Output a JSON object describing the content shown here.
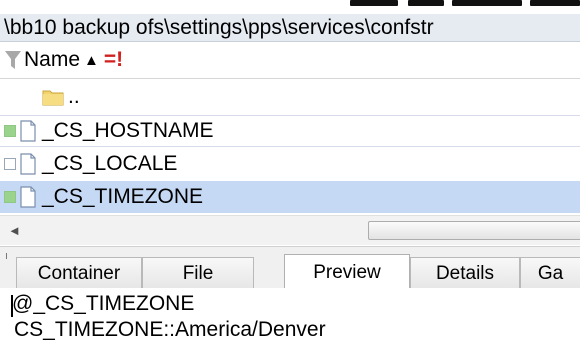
{
  "path_bar": {
    "text": "\\bb10 backup ofs\\settings\\pps\\services\\confstr"
  },
  "list": {
    "header": {
      "name_label": "Name",
      "sort_glyph": "▲",
      "flag": "=!"
    },
    "parent_row": {
      "label": ".."
    },
    "rows": [
      {
        "name": "_CS_HOSTNAME",
        "checkbox": "green"
      },
      {
        "name": "_CS_LOCALE",
        "checkbox": "empty"
      },
      {
        "name": "_CS_TIMEZONE",
        "checkbox": "green",
        "selected": true
      }
    ]
  },
  "scrollbar": {
    "left_arrow": "◄"
  },
  "tabs": [
    {
      "label": "Container"
    },
    {
      "label": "File"
    },
    {
      "label": "Preview",
      "active": true
    },
    {
      "label": "Details"
    },
    {
      "label": "Ga"
    }
  ],
  "preview": {
    "line1": "@_CS_TIMEZONE",
    "line2": "CS_TIMEZONE::America/Denver"
  },
  "icons": [
    "filter-icon",
    "sort-ascending-icon",
    "folder-icon",
    "file-icon",
    "scroll-left-icon"
  ],
  "colors": {
    "selected_row": "#c5d9f4",
    "checkbox_green": "#9ad48c",
    "flag_red": "#d22020",
    "path_bar_bg": "#e6ebf2"
  }
}
